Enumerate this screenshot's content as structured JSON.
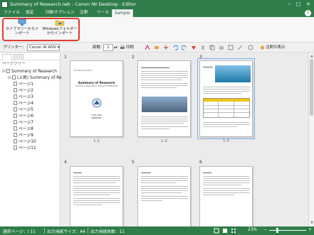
{
  "window": {
    "title": "Summary of Research.iwb - Canon iW Desktop - Editor",
    "min": "–",
    "max": "□",
    "close": "✕"
  },
  "menu": {
    "items": [
      "ファイル",
      "設定",
      "印刷オプション",
      "注釈",
      "ツール",
      "Sample"
    ],
    "help": "?"
  },
  "ribbon": {
    "library_import": [
      "ライブラリーからイ",
      "ンポート"
    ],
    "windows_folder_import": [
      "Windowsフォルダー",
      "からインポート"
    ]
  },
  "toolbar": {
    "printer_label": "プリンター:",
    "printer_value": "Canon iR ADV ▾",
    "copies_label": "部数:",
    "copies_value": "1",
    "print_label": "印刷",
    "annot_display": "注釈の表示"
  },
  "sidebar": {
    "title": "ページツリー",
    "root": "Summary of Research",
    "doc": "(上質) Summary of Rese",
    "pages": [
      "ページ1",
      "ページ2",
      "ページ3",
      "ページ4",
      "ページ5",
      "ページ6",
      "ページ7",
      "ページ8",
      "ページ9",
      "ページ10",
      "ページ11"
    ]
  },
  "pages": {
    "numbers": [
      "1",
      "2",
      "3",
      "4",
      "5",
      "6"
    ],
    "captions": [
      "1-1",
      "1-2",
      "1-3"
    ],
    "p1": {
      "header": "The iW Inspiration",
      "title": "Summary of Research",
      "subtitle": "The Whole of Development of IW and ICW TERM SORT",
      "date": "1 DEC 2014",
      "org": "CANON INC."
    }
  },
  "status": {
    "selected_pages": "選択ページ：/ 11",
    "output_size": "出力用紙サイズ：A4",
    "output_sheets": "出力用紙枚数：11",
    "zoom": "23%",
    "zoom_minus": "−",
    "zoom_plus": "+"
  }
}
